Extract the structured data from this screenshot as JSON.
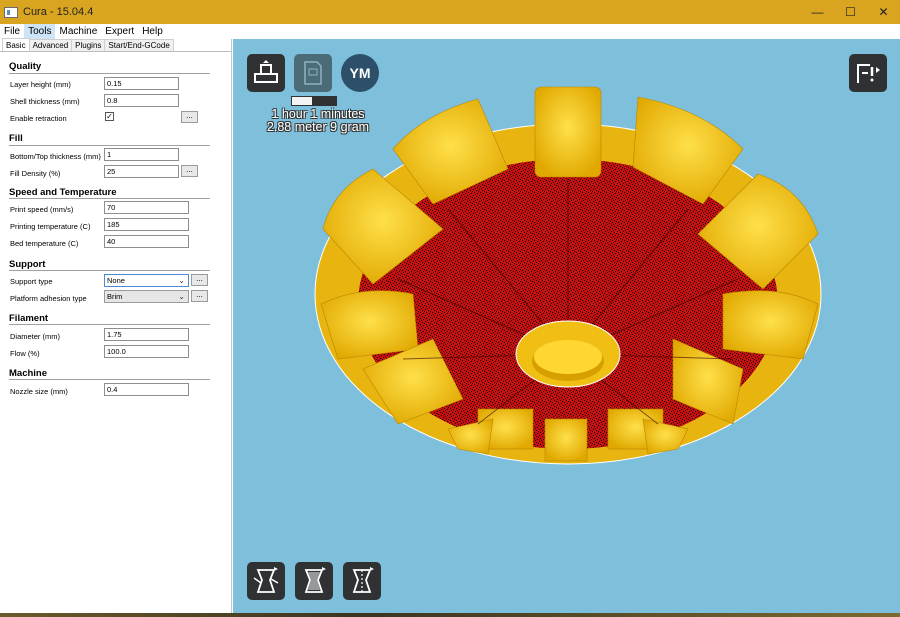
{
  "window": {
    "title": "Cura - 15.04.4",
    "controls": {
      "minimize": "—",
      "maximize": "☐",
      "close": "✕"
    }
  },
  "menu": [
    "File",
    "Tools",
    "Machine",
    "Expert",
    "Help"
  ],
  "tabs": [
    "Basic",
    "Advanced",
    "Plugins",
    "Start/End-GCode"
  ],
  "sections": {
    "quality": {
      "title": "Quality",
      "layer_height": {
        "label": "Layer height (mm)",
        "value": "0.15"
      },
      "shell_thickness": {
        "label": "Shell thickness (mm)",
        "value": "0.8"
      },
      "enable_retraction": {
        "label": "Enable retraction",
        "checked": true
      }
    },
    "fill": {
      "title": "Fill",
      "bottom_top": {
        "label": "Bottom/Top thickness (mm)",
        "value": "1"
      },
      "fill_density": {
        "label": "Fill Density (%)",
        "value": "25"
      }
    },
    "speed": {
      "title": "Speed and Temperature",
      "print_speed": {
        "label": "Print speed (mm/s)",
        "value": "70"
      },
      "printing_temp": {
        "label": "Printing temperature (C)",
        "value": "185"
      },
      "bed_temp": {
        "label": "Bed temperature (C)",
        "value": "40"
      }
    },
    "support": {
      "title": "Support",
      "support_type": {
        "label": "Support type",
        "value": "None"
      },
      "adhesion": {
        "label": "Platform adhesion type",
        "value": "Brim"
      }
    },
    "filament": {
      "title": "Filament",
      "diameter": {
        "label": "Diameter (mm)",
        "value": "1.75"
      },
      "flow": {
        "label": "Flow (%)",
        "value": "100.0"
      }
    },
    "machine": {
      "title": "Machine",
      "nozzle": {
        "label": "Nozzle size (mm)",
        "value": "0.4"
      }
    }
  },
  "dots_label": "...",
  "viewport": {
    "ym_label": "YM",
    "print_time": "1 hour 1 minutes",
    "print_material": "2.88 meter 9 gram",
    "progress_fraction": 0.45,
    "colors": {
      "background": "#7ec0dc",
      "model_yellow": "#f5c518",
      "infill_red": "#cc1010"
    }
  }
}
